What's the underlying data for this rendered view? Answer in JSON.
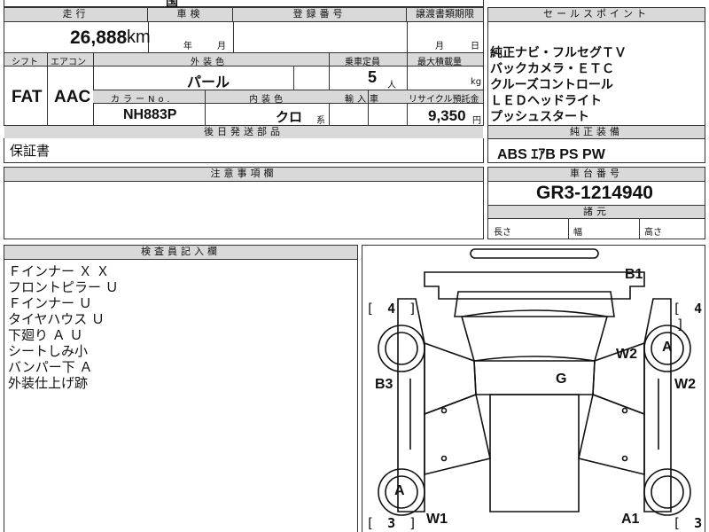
{
  "top_fragment": "国",
  "specs": {
    "headers": {
      "mileage": "走行",
      "inspection": "車検",
      "registration": "登録番号",
      "transfer_deadline": "譲渡書類期限",
      "shift": "シフト",
      "aircon": "エアコン",
      "exterior_color": "外装色",
      "capacity": "乗車定員",
      "max_load": "最大積載量",
      "color_no": "カラーNo.",
      "interior_color": "内装色",
      "import": "輸入車",
      "recycle": "リサイクル預託金",
      "aftersend": "後日発送部品"
    },
    "mileage_value": "26,888",
    "mileage_unit": "km",
    "inspection_year": "年",
    "inspection_month": "月",
    "transfer_month": "月",
    "transfer_day": "日",
    "shift_value": "FAT",
    "aircon_value": "AAC",
    "exterior_color_value": "パール",
    "capacity_value": "5",
    "capacity_unit": "人",
    "load_unit": "kg",
    "color_no_value": "NH883P",
    "interior_color_value": "クロ",
    "interior_suffix": "系",
    "recycle_value": "9,350",
    "recycle_unit": "円",
    "aftersend_value": "保証書"
  },
  "sales_points": {
    "header": "セールスポイント",
    "items": [
      "純正ナビ・フルセグＴＶ",
      "バックカメラ・ＥＴＣ",
      "クルーズコントロール",
      "ＬＥＤヘッドライト",
      "プッシュスタート"
    ]
  },
  "genuine_equipment": {
    "header": "純正装備",
    "value": "ABS ｴｱB PS PW"
  },
  "notes": {
    "header": "注意事項欄"
  },
  "chassis": {
    "header": "車台番号",
    "value": "GR3-1214940",
    "dims_header": "諸元",
    "length": "長さ",
    "width": "幅",
    "height": "高さ"
  },
  "inspector": {
    "header": "検査員記入欄",
    "lines": [
      "Ｆインナー Ｘ Ｘ",
      "フロントピラー Ｕ",
      "Ｆインナー Ｕ",
      "タイヤハウス Ｕ",
      "下廻り Ａ Ｕ",
      "シートしみ小",
      "バンパー下 Ａ",
      "外装仕上げ跡"
    ]
  },
  "diagram": {
    "marks": {
      "b1": "B1",
      "w2_right": "W2",
      "a_front_right": "A",
      "w2_edge": "W2",
      "b3": "B3",
      "g": "G",
      "a_rear_left": "A",
      "w1": "W1",
      "a1": "A1"
    },
    "brackets": {
      "left_top_open": "[",
      "left_top_num": "4",
      "left_top_close": "]",
      "right_top_open": "[",
      "right_top_num": "4",
      "right_top_close": "]",
      "left_bottom_open": "[",
      "left_bottom_num": "3",
      "left_bottom_close": "]",
      "right_bottom_open": "[",
      "right_bottom_num": "3"
    }
  }
}
